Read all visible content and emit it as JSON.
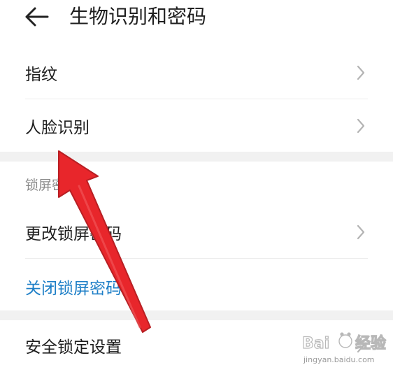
{
  "header": {
    "title": "生物识别和密码",
    "back_icon": "arrow-left-icon"
  },
  "biometrics": {
    "items": [
      {
        "label": "指纹"
      },
      {
        "label": "人脸识别"
      }
    ]
  },
  "lock_screen": {
    "section_title": "锁屏密码",
    "change_label": "更改锁屏密码",
    "disable_label": "关闭锁屏密码"
  },
  "security": {
    "lock_settings_label": "安全锁定设置"
  },
  "watermark": {
    "url": "jingyan.baidu.com"
  },
  "colors": {
    "link": "#1e7fc7",
    "annotation_arrow": "#e8262b"
  }
}
